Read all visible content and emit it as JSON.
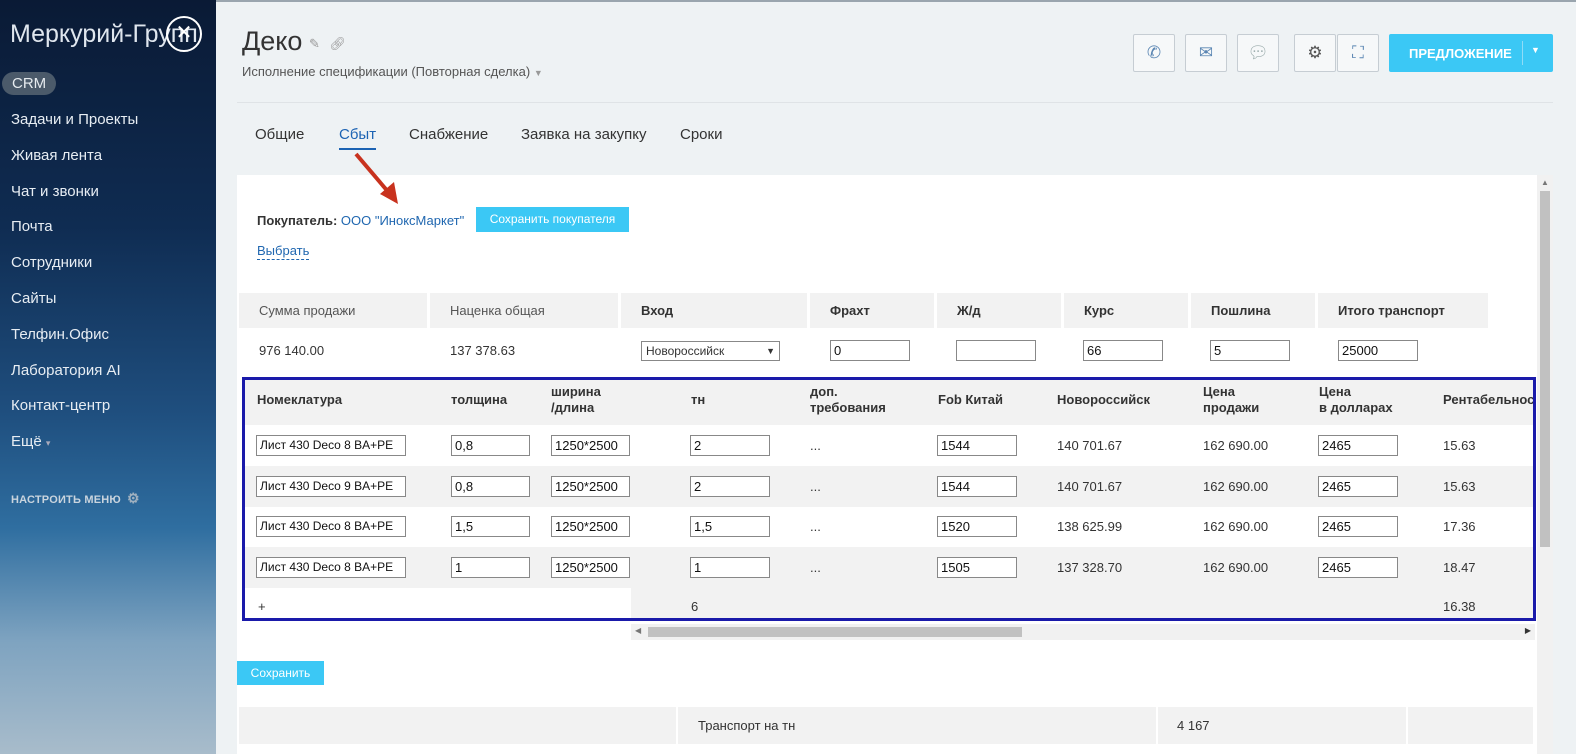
{
  "sidebar": {
    "brand": "Меркурий-Групп",
    "crm_badge": "CRM",
    "items": [
      {
        "label": "Задачи и Проекты"
      },
      {
        "label": "Живая лента"
      },
      {
        "label": "Чат и звонки"
      },
      {
        "label": "Почта"
      },
      {
        "label": "Сотрудники"
      },
      {
        "label": "Сайты"
      },
      {
        "label": "Телфин.Офис"
      },
      {
        "label": "Лаборатория AI"
      },
      {
        "label": "Контакт-центр"
      },
      {
        "label": "Ещё"
      }
    ],
    "configure_menu": "НАСТРОИТЬ МЕНЮ"
  },
  "header": {
    "title": "Деко",
    "subtitle": "Исполнение спецификации (Повторная сделка)",
    "offer_button": "ПРЕДЛОЖЕНИЕ",
    "accent_color": "#3bc8f5"
  },
  "tabs": [
    {
      "label": "Общие"
    },
    {
      "label": "Сбыт",
      "active": true
    },
    {
      "label": "Снабжение"
    },
    {
      "label": "Заявка на закупку"
    },
    {
      "label": "Сроки"
    }
  ],
  "buyer": {
    "label": "Покупатель:",
    "name": "ООО \"ИноксМаркет\"",
    "save_button": "Сохранить покупателя",
    "choose_link": "Выбрать"
  },
  "summary": {
    "headers": [
      "Сумма продажи",
      "Наценка общая",
      "Вход",
      "Фрахт",
      "Ж/д",
      "Курс",
      "Пошлина",
      "Итого транспорт"
    ],
    "sale_sum": "976 140.00",
    "markup_total": "137 378.63",
    "entry_port": "Новороссийск",
    "freight": "0",
    "rail": "",
    "rate": "66",
    "duty": "5",
    "transport_total": "25000"
  },
  "table": {
    "headers": {
      "nomenclature": "Номеклатура",
      "thickness": "толщина",
      "width_length": "ширина\n/длина",
      "tn": "тн",
      "extra": "доп.\nтребования",
      "fob": "Fob Китай",
      "novoross": "Новороссийск",
      "sale_price": "Цена\nпродажи",
      "usd_price": "Цена\nв долларах",
      "profit": "Рентабельность"
    },
    "rows": [
      {
        "name": "Лист 430 Deco 8 BA+PE",
        "thickness": "0,8",
        "size": "1250*2500",
        "tn": "2",
        "extra": "...",
        "fob": "1544",
        "novoross": "140 701.67",
        "sale": "162 690.00",
        "usd": "2465",
        "profit": "15.63"
      },
      {
        "name": "Лист 430 Deco 9 BA+PE",
        "thickness": "0,8",
        "size": "1250*2500",
        "tn": "2",
        "extra": "...",
        "fob": "1544",
        "novoross": "140 701.67",
        "sale": "162 690.00",
        "usd": "2465",
        "profit": "15.63"
      },
      {
        "name": "Лист 430 Deco 8 BA+PE",
        "thickness": "1,5",
        "size": "1250*2500",
        "tn": "1,5",
        "extra": "...",
        "fob": "1520",
        "novoross": "138 625.99",
        "sale": "162 690.00",
        "usd": "2465",
        "profit": "17.36"
      },
      {
        "name": "Лист 430 Deco 8 BA+PE",
        "thickness": "1",
        "size": "1250*2500",
        "tn": "1",
        "extra": "...",
        "fob": "1505",
        "novoross": "137 328.70",
        "sale": "162 690.00",
        "usd": "2465",
        "profit": "18.47"
      }
    ],
    "footer": {
      "add": "+",
      "tn_total": "6",
      "profit_avg": "16.38"
    }
  },
  "save_button": "Сохранить",
  "transport": {
    "label": "Транспорт на тн",
    "value": "4 167"
  }
}
